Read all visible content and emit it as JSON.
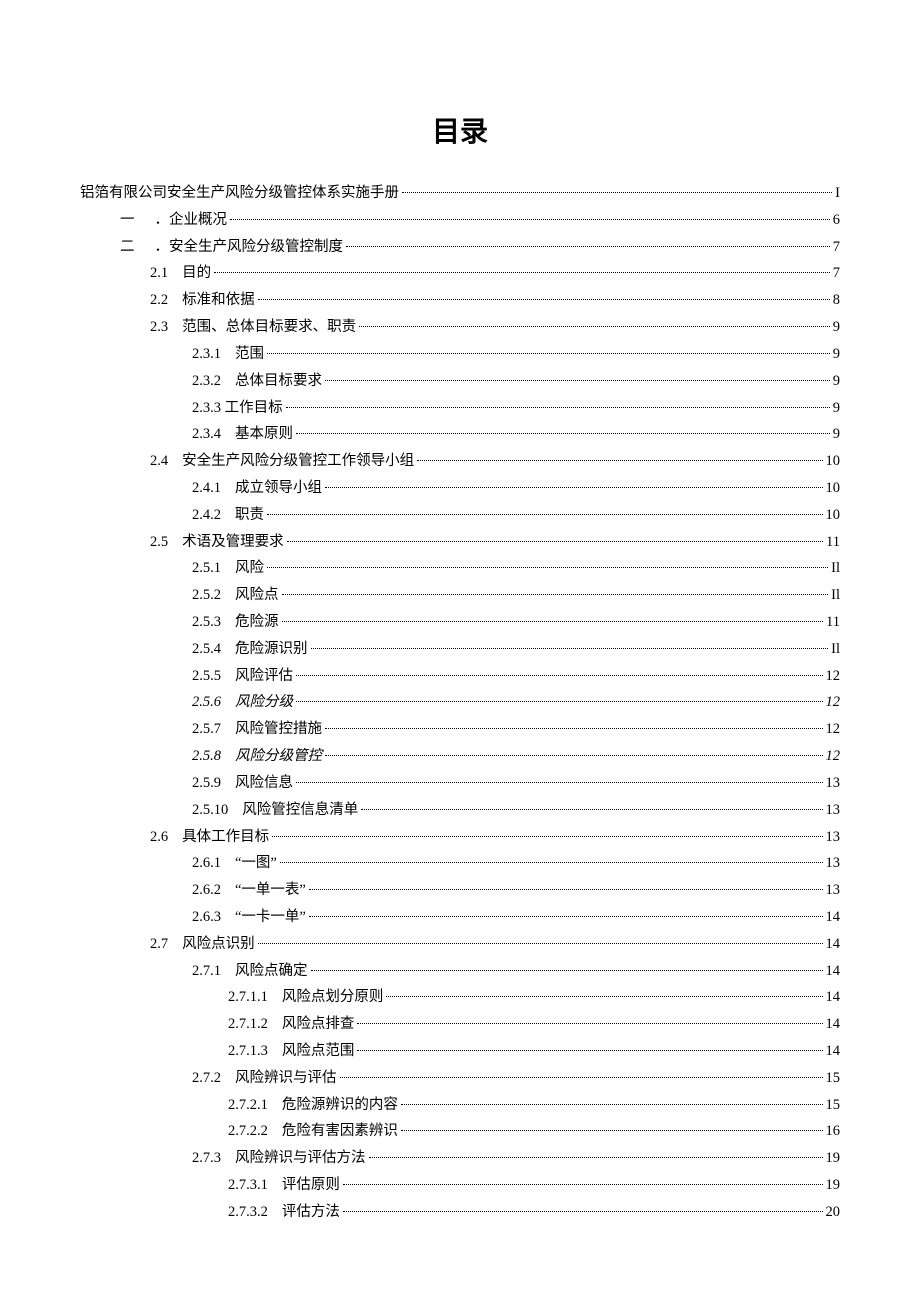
{
  "title": "目录",
  "entries": [
    {
      "level": 0,
      "num": "",
      "text": "铝箔有限公司安全生产风险分级管控体系实施手册",
      "page": "I"
    },
    {
      "level": 1,
      "num": "一",
      "text": "．企业概况",
      "page": "6"
    },
    {
      "level": 1,
      "num": "二",
      "text": "．安全生产风险分级管控制度",
      "page": "7"
    },
    {
      "level": 2,
      "num": "2.1",
      "text": "目的",
      "page": "7"
    },
    {
      "level": 2,
      "num": "2.2",
      "text": "标准和依据",
      "page": "8"
    },
    {
      "level": 2,
      "num": "2.3",
      "text": "范围、总体目标要求、职责",
      "page": "9"
    },
    {
      "level": 3,
      "num": "2.3.1",
      "text": "范围",
      "page": "9"
    },
    {
      "level": 3,
      "num": "2.3.2",
      "text": "总体目标要求",
      "page": "9"
    },
    {
      "level": 3,
      "num": "",
      "text": "2.3.3 工作目标",
      "page": "9"
    },
    {
      "level": 3,
      "num": "2.3.4",
      "text": "基本原则",
      "page": "9"
    },
    {
      "level": 2,
      "num": "2.4",
      "text": "安全生产风险分级管控工作领导小组",
      "page": "10"
    },
    {
      "level": 3,
      "num": "2.4.1",
      "text": "成立领导小组",
      "page": "10"
    },
    {
      "level": 3,
      "num": "2.4.2",
      "text": "职责",
      "page": "10"
    },
    {
      "level": 2,
      "num": "2.5",
      "text": "术语及管理要求",
      "page": "11"
    },
    {
      "level": 3,
      "num": "2.5.1",
      "text": "风险",
      "page": "Il"
    },
    {
      "level": 3,
      "num": "2.5.2",
      "text": "风险点",
      "page": "Il"
    },
    {
      "level": 3,
      "num": "2.5.3",
      "text": "危险源",
      "page": "11"
    },
    {
      "level": 3,
      "num": "2.5.4",
      "text": "危险源识别",
      "page": "Il"
    },
    {
      "level": 3,
      "num": "2.5.5",
      "text": "风险评估",
      "page": "12"
    },
    {
      "level": 3,
      "num": "2.5.6",
      "text": "风险分级",
      "page": "12",
      "italic": true
    },
    {
      "level": 3,
      "num": "2.5.7",
      "text": "风险管控措施",
      "page": "12"
    },
    {
      "level": 3,
      "num": "2.5.8",
      "text": "风险分级管控",
      "page": "12",
      "italic": true
    },
    {
      "level": 3,
      "num": "2.5.9",
      "text": "风险信息",
      "page": "13"
    },
    {
      "level": 3,
      "num": "2.5.10",
      "text": "风险管控信息清单",
      "page": "13"
    },
    {
      "level": 2,
      "num": "2.6",
      "text": "具体工作目标",
      "page": "13"
    },
    {
      "level": 3,
      "num": "2.6.1",
      "text": "“一图”",
      "page": "13"
    },
    {
      "level": 3,
      "num": "2.6.2",
      "text": "“一单一表”",
      "page": "13"
    },
    {
      "level": 3,
      "num": "2.6.3",
      "text": "“一卡一单”",
      "page": "14"
    },
    {
      "level": 2,
      "num": "2.7",
      "text": "风险点识别",
      "page": "14"
    },
    {
      "level": 3,
      "num": "2.7.1",
      "text": "风险点确定",
      "page": "14"
    },
    {
      "level": 4,
      "num": "2.7.1.1",
      "text": "风险点划分原则",
      "page": "14"
    },
    {
      "level": 4,
      "num": "2.7.1.2",
      "text": "风险点排查",
      "page": "14"
    },
    {
      "level": 4,
      "num": "2.7.1.3",
      "text": "风险点范围",
      "page": "14"
    },
    {
      "level": 3,
      "num": "2.7.2",
      "text": "风险辨识与评估",
      "page": "15"
    },
    {
      "level": 4,
      "num": "2.7.2.1",
      "text": "危险源辨识的内容",
      "page": "15"
    },
    {
      "level": 4,
      "num": "2.7.2.2",
      "text": "危险有害因素辨识",
      "page": "16"
    },
    {
      "level": 3,
      "num": "2.7.3",
      "text": "风险辨识与评估方法",
      "page": "19"
    },
    {
      "level": 4,
      "num": "2.7.3.1",
      "text": "评估原则",
      "page": "19"
    },
    {
      "level": 4,
      "num": "2.7.3.2",
      "text": "评估方法",
      "page": "20"
    }
  ]
}
